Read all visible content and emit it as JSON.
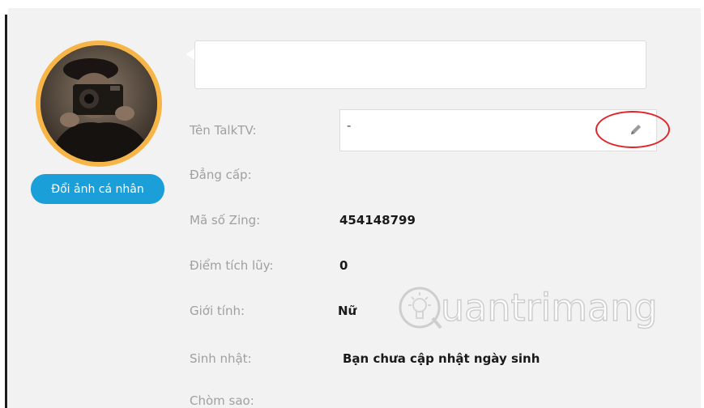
{
  "profile": {
    "change_avatar_label": "Đổi ảnh cá nhân",
    "status_placeholder": ""
  },
  "fields": {
    "talktv_name": {
      "label": "Tên TalkTV:",
      "value": "-"
    },
    "rank": {
      "label": "Đẳng cấp:",
      "value": ""
    },
    "zing_id": {
      "label": "Mã số Zing:",
      "value": "454148799"
    },
    "points": {
      "label": "Điểm tích lũy:",
      "value": "0"
    },
    "gender": {
      "label": "Giới tính:",
      "value": "Nữ"
    },
    "birthday": {
      "label": "Sinh nhật:",
      "value": "Bạn chưa cập nhật ngày sinh"
    },
    "zodiac": {
      "label": "Chòm sao:",
      "value": ""
    }
  },
  "watermark": {
    "text": "uantrimang"
  },
  "colors": {
    "accent_blue": "#1a9fd9",
    "avatar_ring": "#f7b548",
    "highlight_red": "#e0252b"
  },
  "icons": {
    "edit": "pencil-icon"
  }
}
